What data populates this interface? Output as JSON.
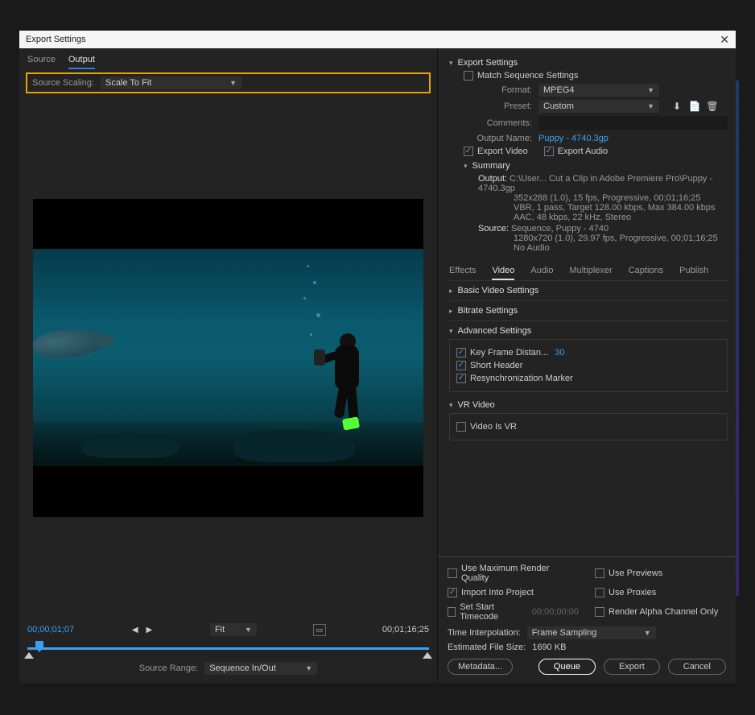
{
  "dialog": {
    "title": "Export Settings"
  },
  "left": {
    "tabs": {
      "source": "Source",
      "output": "Output"
    },
    "scaling": {
      "label": "Source Scaling:",
      "value": "Scale To Fit"
    },
    "timecode_left": "00;00;01;07",
    "timecode_right": "00;01;16;25",
    "fit": "Fit",
    "source_range_label": "Source Range:",
    "source_range_value": "Sequence In/Out"
  },
  "export": {
    "header": "Export Settings",
    "match": "Match Sequence Settings",
    "format_label": "Format:",
    "format_value": "MPEG4",
    "preset_label": "Preset:",
    "preset_value": "Custom",
    "comments_label": "Comments:",
    "comments_value": "",
    "outputname_label": "Output Name:",
    "outputname_value": "Puppy - 4740.3gp",
    "export_video": "Export Video",
    "export_audio": "Export Audio",
    "summary_label": "Summary",
    "summary": {
      "output_label": "Output:",
      "output_lines": [
        "C:\\User... Cut a Clip in Adobe Premiere Pro\\Puppy - 4740.3gp",
        "352x288 (1.0), 15 fps, Progressive, 00;01;16;25",
        "VBR, 1 pass, Target 128.00 kbps, Max 384.00 kbps",
        "AAC, 48 kbps, 22 kHz, Stereo"
      ],
      "source_label": "Source:",
      "source_lines": [
        "Sequence, Puppy - 4740",
        "1280x720 (1.0), 29.97 fps, Progressive, 00;01;16;25",
        "No Audio"
      ]
    }
  },
  "tabs2": {
    "effects": "Effects",
    "video": "Video",
    "audio": "Audio",
    "multiplexer": "Multiplexer",
    "captions": "Captions",
    "publish": "Publish"
  },
  "video": {
    "basic": "Basic Video Settings",
    "bitrate": "Bitrate Settings",
    "advanced": "Advanced Settings",
    "keyframe_label": "Key Frame Distan...",
    "keyframe_value": "30",
    "short_header": "Short Header",
    "resync": "Resynchronization Marker",
    "vr_header": "VR Video",
    "video_is_vr": "Video Is VR"
  },
  "footer": {
    "max_render": "Use Maximum Render Quality",
    "previews": "Use Previews",
    "import_project": "Import Into Project",
    "proxies": "Use Proxies",
    "set_start_tc": "Set Start Timecode",
    "start_tc_value": "00;00;00;00",
    "render_alpha": "Render Alpha Channel Only",
    "time_interp_label": "Time Interpolation:",
    "time_interp_value": "Frame Sampling",
    "est_label": "Estimated File Size:",
    "est_value": "1690 KB",
    "metadata": "Metadata...",
    "queue": "Queue",
    "export": "Export",
    "cancel": "Cancel"
  }
}
